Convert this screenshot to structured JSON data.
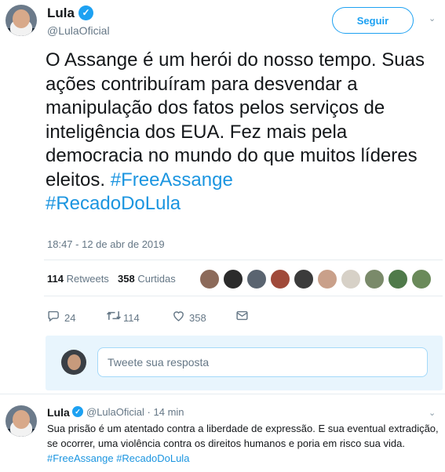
{
  "tweet": {
    "author": {
      "name": "Lula",
      "handle": "@LulaOficial",
      "verified_glyph": "✓"
    },
    "follow_label": "Seguir",
    "caret": "⌄",
    "text_parts": [
      "O Assange é um herói do nosso tempo. Suas ações contribuíram para desvendar a manipulação dos fatos pelos serviços de inteligência dos EUA. Fez mais pela democracia no mundo do que muitos líderes eleitos. "
    ],
    "hashtags": [
      "#FreeAssange",
      "#RecadoDoLula"
    ],
    "timestamp": "18:47 - 12 de abr de 2019",
    "stats": {
      "retweets_count": "114",
      "retweets_label": "Retweets",
      "likes_count": "358",
      "likes_label": "Curtidas"
    },
    "liker_colors": [
      "#8c6a5a",
      "#2b2b2b",
      "#5a6470",
      "#a04a3a",
      "#3b3b3b",
      "#c9a08a",
      "#d7d1c7",
      "#7a8a6a",
      "#4f7a4a",
      "#6a8a5a"
    ],
    "actions": {
      "reply_icon": "reply-icon",
      "reply_count": "24",
      "retweet_icon": "retweet-icon",
      "retweet_count": "114",
      "like_icon": "heart-icon",
      "like_count": "358",
      "dm_icon": "envelope-icon"
    },
    "reply_placeholder": "Tweete sua resposta"
  },
  "reply_tweet": {
    "name": "Lula",
    "handle": "@LulaOficial",
    "dot": "·",
    "time": "14 min",
    "text": "Sua prisão é um atentado contra a liberdade de expressão. E sua eventual extradição, se ocorrer, uma violência contra os direitos humanos e poria em risco sua vida. ",
    "hashtags": [
      "#FreeAssange",
      "#RecadoDoLula"
    ]
  },
  "colors": {
    "accent": "#1da1f2",
    "hashtag": "#1b95e0",
    "muted": "#657786",
    "reply_bg": "#e8f5fd"
  }
}
